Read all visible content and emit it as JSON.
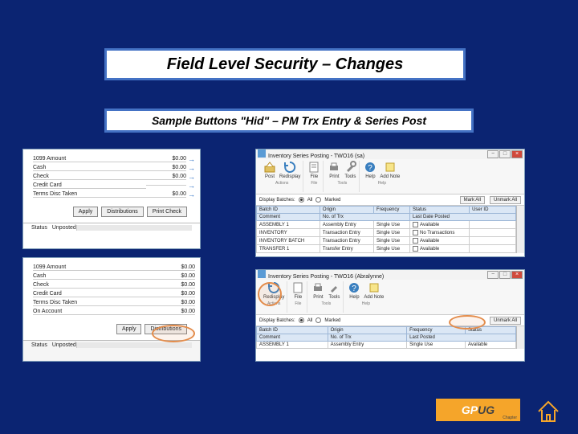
{
  "title": "Field Level Security – Changes",
  "subtitle": "Sample Buttons \"Hid\" – PM Trx Entry & Series Post",
  "left_top": {
    "rows": [
      {
        "label": "1099 Amount",
        "value": "$0.00"
      },
      {
        "label": "Cash",
        "value": "$0.00"
      },
      {
        "label": "Check",
        "value": "$0.00"
      },
      {
        "label": "Credit Card",
        "value": ""
      },
      {
        "label": "Terms Disc Taken",
        "value": "$0.00"
      }
    ],
    "buttons": {
      "apply": "Apply",
      "distribute": "Distributions",
      "print": "Print Check"
    },
    "status_label": "Status",
    "status_value": "Unposted"
  },
  "left_bottom": {
    "rows": [
      {
        "label": "1099 Amount",
        "value": "$0.00"
      },
      {
        "label": "Cash",
        "value": "$0.00"
      },
      {
        "label": "Check",
        "value": "$0.00"
      },
      {
        "label": "Credit Card",
        "value": "$0.00"
      },
      {
        "label": "Terms Disc Taken",
        "value": "$0.00"
      },
      {
        "label": "On Account",
        "value": "$0.00"
      }
    ],
    "buttons": {
      "apply": "Apply",
      "distribute": "Distributions"
    },
    "status_label": "Status",
    "status_value": "Unposted"
  },
  "right_top": {
    "title": "Inventory Series Posting - TWO16 (sa)",
    "ribbon": {
      "group1": [
        "Post",
        "Redisplay"
      ],
      "group2": [
        "File"
      ],
      "group3": [
        "Print",
        "Tools"
      ],
      "group4": [
        "Help",
        "Add Note"
      ],
      "labels": {
        "g1": "Actions",
        "g2": "File",
        "g3": "Tools",
        "g4": "Help"
      }
    },
    "display_label": "Display Batches:",
    "radio_all": "All",
    "radio_marked": "Marked",
    "mark_all": "Mark All",
    "unmark_all": "Unmark All",
    "columns": [
      "Batch ID",
      "Origin",
      "Frequency",
      "Status",
      "",
      "User ID"
    ],
    "sub_columns": [
      "Comment",
      "No. of Trx",
      "Last Date Posted"
    ],
    "rows": [
      {
        "batch": "ASSEMBLY 1",
        "origin": "Assembly Entry",
        "freq": "Single Use",
        "status": "Available"
      },
      {
        "batch": "INVENTORY",
        "origin": "Transaction Entry",
        "freq": "Single Use",
        "status": "No Transactions"
      },
      {
        "batch": "INVENTORY BATCH",
        "origin": "Transaction Entry",
        "freq": "Single Use",
        "status": "Available"
      },
      {
        "batch": "TRANSFER 1",
        "origin": "Transfer Entry",
        "freq": "Single Use",
        "status": "Available"
      }
    ]
  },
  "right_bottom": {
    "title": "Inventory Series Posting - TWO16 (Abralynne)",
    "ribbon": {
      "group1": [
        "Redisplay"
      ],
      "group2": [
        "File"
      ],
      "group3": [
        "Print",
        "Tools"
      ],
      "group4": [
        "Help",
        "Add Note"
      ],
      "labels": {
        "g1": "Actions",
        "g2": "File",
        "g3": "Tools",
        "g4": "Help"
      }
    },
    "display_label": "Display Batches:",
    "radio_all": "All",
    "radio_marked": "Marked",
    "unmark_all": "Unmark All",
    "columns": [
      "Batch ID",
      "Origin",
      "Frequency",
      "Status"
    ],
    "sub_columns": [
      "No. of Trx",
      "Last Posted"
    ],
    "rows": [
      {
        "batch": "ASSEMBLY 1",
        "origin": "Assembly Entry",
        "freq": "Single Use",
        "status": "Available"
      }
    ]
  },
  "logo": {
    "gp": "GP",
    "ug": "UG",
    "tag": "Chapter"
  }
}
